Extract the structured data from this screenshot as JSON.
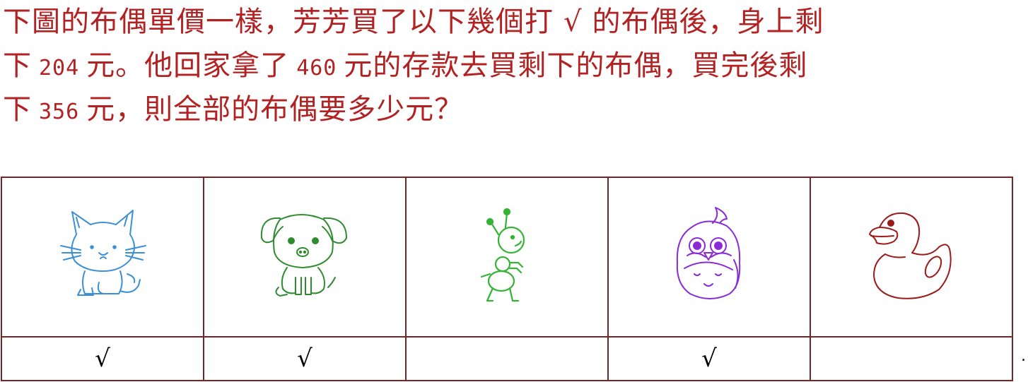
{
  "question": {
    "line1": {
      "before": "下圖的布偶單價一樣，芳芳買了以下幾個打",
      "tick": "√",
      "after": "的布偶後，身上剩"
    },
    "line2": {
      "a": "下",
      "n1": "204",
      "b": "元。他回家拿了",
      "n2": "460",
      "c": "元的存款去買剩下的布偶，買完後剩"
    },
    "line3": {
      "a": "下",
      "n1": "356",
      "b": "元，則全部的布偶要多少元？"
    }
  },
  "table": {
    "dolls": [
      {
        "name": "cat",
        "color": "#3b8fd6",
        "checked": true
      },
      {
        "name": "dog",
        "color": "#2e8b2e",
        "checked": true
      },
      {
        "name": "ant",
        "color": "#34b334",
        "checked": false
      },
      {
        "name": "owl",
        "color": "#8a2bd6",
        "checked": true
      },
      {
        "name": "duck",
        "color": "#9b1b1b",
        "checked": false
      }
    ],
    "marks": [
      "√",
      "√",
      "",
      "√",
      ""
    ]
  },
  "trailing_mark": "."
}
